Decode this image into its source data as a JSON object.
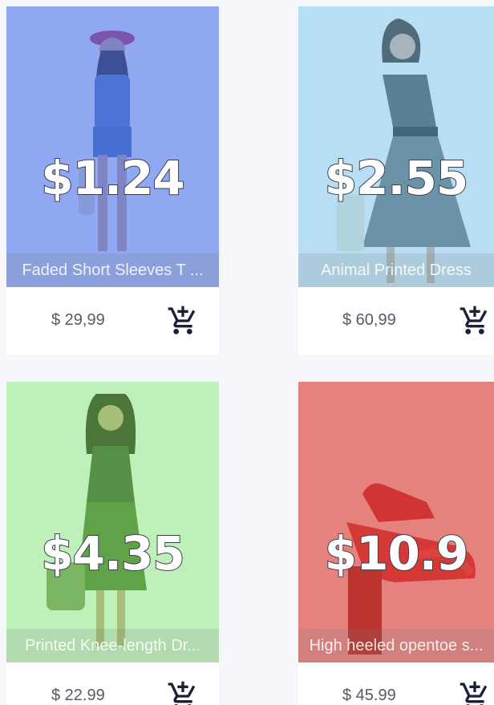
{
  "products": [
    {
      "name": "Faded Short Sleeves T ...",
      "price": "$ 29,99",
      "overlay_price": "$1.24",
      "tint": "rgba(66,110,240,0.55)",
      "image": "woman-in-hat-tshirt-shorts"
    },
    {
      "name": "Animal Printed Dress",
      "price": "$ 60,99",
      "overlay_price": "$2.55",
      "tint": "rgba(110,196,245,0.45)",
      "image": "woman-in-printed-dress"
    },
    {
      "name": "Printed Knee-length Dr...",
      "price": "$ 22.99",
      "overlay_price": "$4.35",
      "tint": "rgba(120,240,110,0.42)",
      "image": "woman-in-floral-dress"
    },
    {
      "name": "High heeled opentoe s...",
      "price": "$ 45.99",
      "overlay_price": "$10.9",
      "tint": "rgba(228,60,60,0.55)",
      "image": "red-high-heeled-sandal"
    }
  ],
  "colors": {
    "background": "#f6f7fa",
    "price_text": "#555a66",
    "cart_icon": "#1a1f3a"
  },
  "icons": {
    "cart": "add-shopping-cart-icon"
  }
}
